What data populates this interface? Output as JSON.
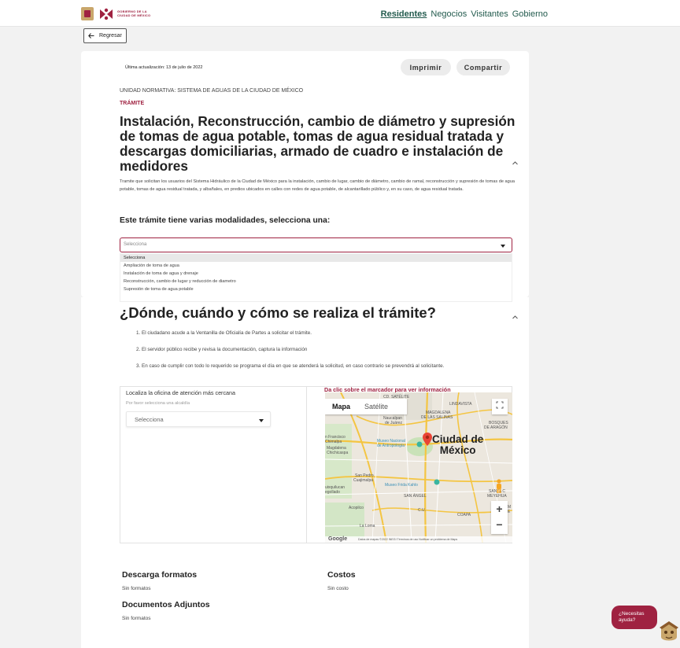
{
  "header": {
    "logo_text_1": "GOBIERNO DE LA",
    "logo_text_2": "CIUDAD DE MÉXICO",
    "nav": [
      "Residentes",
      "Negocios",
      "Visitantes",
      "Gobierno"
    ],
    "active_nav": "Residentes"
  },
  "back_label": "Regresar",
  "updated": "Última actualización: 13 de julio de 2022",
  "actions": {
    "print": "Imprimir",
    "share": "Compartir"
  },
  "unidad": "UNIDAD NORMATIVA: SISTEMA DE AGUAS DE LA CIUDAD DE MÉXICO",
  "tramite_label": "TRÁMITE",
  "title": "Instalación, Reconstrucción, cambio de diámetro y supresión de tomas de agua potable, tomas de agua residual tratada y descargas domiciliarias, armado de cuadro e instalación de medidores",
  "description": "Tramite que solicitan los usuarios del Sistema Hidráulico de la Ciudad de México para la instalación, cambio de lugar, cambio de diámetro, cambio de ramal, reconstrucción y supresión de tomas de agua potable, tomas de agua residual tratada, y albañales, en predios ubicados en calles con redes de agua potable, de alcantarillado público y, en su caso, de agua residual tratada.",
  "modalidades": {
    "heading": "Este trámite tiene varias modalidades, selecciona una:",
    "placeholder": "Selecciona",
    "options": [
      "Selecciona",
      "Ampliación de toma de agua",
      "Instalación de toma de agua y drenaje",
      "Reconstrucción, cambio de lugar y reducción de diametro",
      "Supresión de toma de agua potable"
    ],
    "selected_index": 0
  },
  "donde": {
    "heading": "¿Dónde, cuándo y cómo se realiza el trámite?",
    "steps": [
      "1. El ciudadano acude a la Ventanilla de Oficialía de Partes a solicitar el trámite.",
      "2. El servidor público recibe y revisa la documentación, captura la información",
      "3. En caso de cumplir con todo lo requerido se programa el día en que se atenderá la solicitud, en caso contrario se prevendrá al solicitante."
    ]
  },
  "locator": {
    "title": "Localiza la oficina de atención más cercana",
    "hint": "Por favor selecciona una alcaldía",
    "select_value": "Selecciona",
    "map_note": "Da clic sobre el marcador para ver información"
  },
  "map": {
    "tab_map": "Mapa",
    "tab_sat": "Satélite",
    "city_line1": "Ciudad de",
    "city_line2": "México",
    "labels": {
      "satelite": "CD. SATÉLITE",
      "lindavista": "LINDAVISTA",
      "magdalena": "MAGDALENA",
      "salinas": "DE LAS SALINAS",
      "naucalpan": "Naucalpan",
      "juarez": "de Juárez",
      "bosques": "BOSQUES",
      "aragon": "DE ARAGÓN",
      "sanfran": "n Francisco",
      "chimalpa": "Chimalpa",
      "museo": "Museo Nacional",
      "antropologia": "de Antropología",
      "magda2": "Magdalena",
      "chichicaspa": "Chichicaspa",
      "sanpedro": "San Pedro",
      "cuajimalpa": "Cuajimalpa",
      "frida": "Museo Frida Kahlo",
      "huixquilucan": "uixquilucan",
      "degollado": "egollado",
      "sanangel": "SAN ÁNGEL",
      "santacruz": "SANTA C",
      "meyehua": "MEYEHUA",
      "acopilco": "Acopilco",
      "cu": "C.U.",
      "copa": "COAPA",
      "laloma": "La Loma",
      "e": "E",
      "m": "M",
      "google": "Google",
      "footer": "Datos de mapas ©2022 INEGI   Términos de uso   Notificar un problema de Maps"
    }
  },
  "descarga": {
    "heading": "Descarga formatos",
    "text": "Sin formatos"
  },
  "costos": {
    "heading": "Costos",
    "text": "Sin costo"
  },
  "adjuntos": {
    "heading": "Documentos Adjuntos",
    "text": "Sin formatos"
  },
  "help": {
    "line1": "¿Necesitas",
    "line2": "ayuda?"
  },
  "colors": {
    "brand": "#9f2241",
    "green": "#235b4e",
    "gold": "#c9a66b"
  },
  "icons": [
    "back-arrow-icon",
    "chevron-up-icon",
    "caret-down-icon",
    "map-marker-icon",
    "fullscreen-icon",
    "pegman-icon",
    "zoom-in-icon",
    "zoom-out-icon"
  ]
}
